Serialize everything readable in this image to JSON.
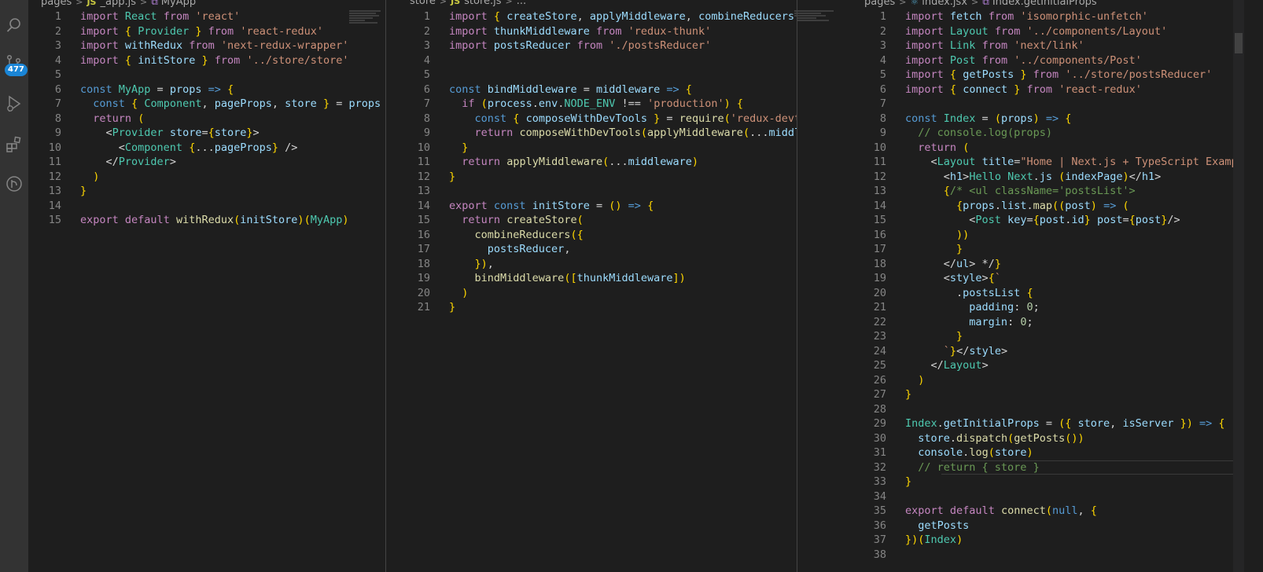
{
  "activity_bar": {
    "source_control_badge": "477"
  },
  "panes": [
    {
      "breadcrumb": [
        "pages",
        "_app.js",
        "MyApp"
      ],
      "lines": [
        "import React from 'react'",
        "import { Provider } from 'react-redux'",
        "import withRedux from 'next-redux-wrapper'",
        "import { initStore } from '../store/store'",
        "",
        "const MyApp = props => {",
        "  const { Component, pageProps, store } = props",
        "  return (",
        "    <Provider store={store}>",
        "      <Component {...pageProps} />",
        "    </Provider>",
        "  )",
        "}",
        "",
        "export default withRedux(initStore)(MyApp)"
      ]
    },
    {
      "breadcrumb": [
        "store",
        "store.js",
        "..."
      ],
      "lines": [
        "import { createStore, applyMiddleware, combineReducers } from 'redux'",
        "import thunkMiddleware from 'redux-thunk'",
        "import postsReducer from './postsReducer'",
        "",
        "",
        "const bindMiddleware = middleware => {",
        "  if (process.env.NODE_ENV !== 'production') {",
        "    const { composeWithDevTools } = require('redux-devtools-extension')",
        "    return composeWithDevTools(applyMiddleware(...middleware))",
        "  }",
        "  return applyMiddleware(...middleware)",
        "}",
        "",
        "export const initStore = () => {",
        "  return createStore(",
        "    combineReducers({",
        "      postsReducer,",
        "    }),",
        "    bindMiddleware([thunkMiddleware])",
        "  )",
        "}"
      ]
    },
    {
      "breadcrumb": [
        "pages",
        "index.jsx",
        "Index.getInitialProps"
      ],
      "lines": [
        "import fetch from 'isomorphic-unfetch'",
        "import Layout from '../components/Layout'",
        "import Link from 'next/link'",
        "import Post from '../components/Post'",
        "import { getPosts } from '../store/postsReducer'",
        "import { connect } from 'react-redux'",
        "",
        "const Index = (props) => {",
        "  // console.log(props)",
        "  return (",
        "    <Layout title=\"Home | Next.js + TypeScript Example\">",
        "      <h1>Hello Next.js (indexPage)</h1>",
        "      {/* <ul className='postsList'>",
        "        {props.list.map((post) => (",
        "          <Post key={post.id} post={post}/>",
        "        ))",
        "        }",
        "      </ul> */}",
        "      <style>{`",
        "        .postsList {",
        "          padding: 0;",
        "          margin: 0;",
        "        }",
        "      `}</style>",
        "    </Layout>",
        "  )",
        "}",
        "",
        "Index.getInitialProps = ({ store, isServer }) => {",
        "  store.dispatch(getPosts())",
        "  console.log(store)",
        "  // return { store }",
        "}",
        "",
        "export default connect(null, {",
        "  getPosts",
        "})(Index)",
        ""
      ]
    }
  ],
  "colors": {
    "editor_bg": "#1e1e1e",
    "activity_bar": "#333333",
    "badge": "#1a85d6"
  },
  "icons": [
    "search-icon",
    "source-control-icon",
    "run-debug-icon",
    "extensions-icon",
    "remote-icon"
  ]
}
